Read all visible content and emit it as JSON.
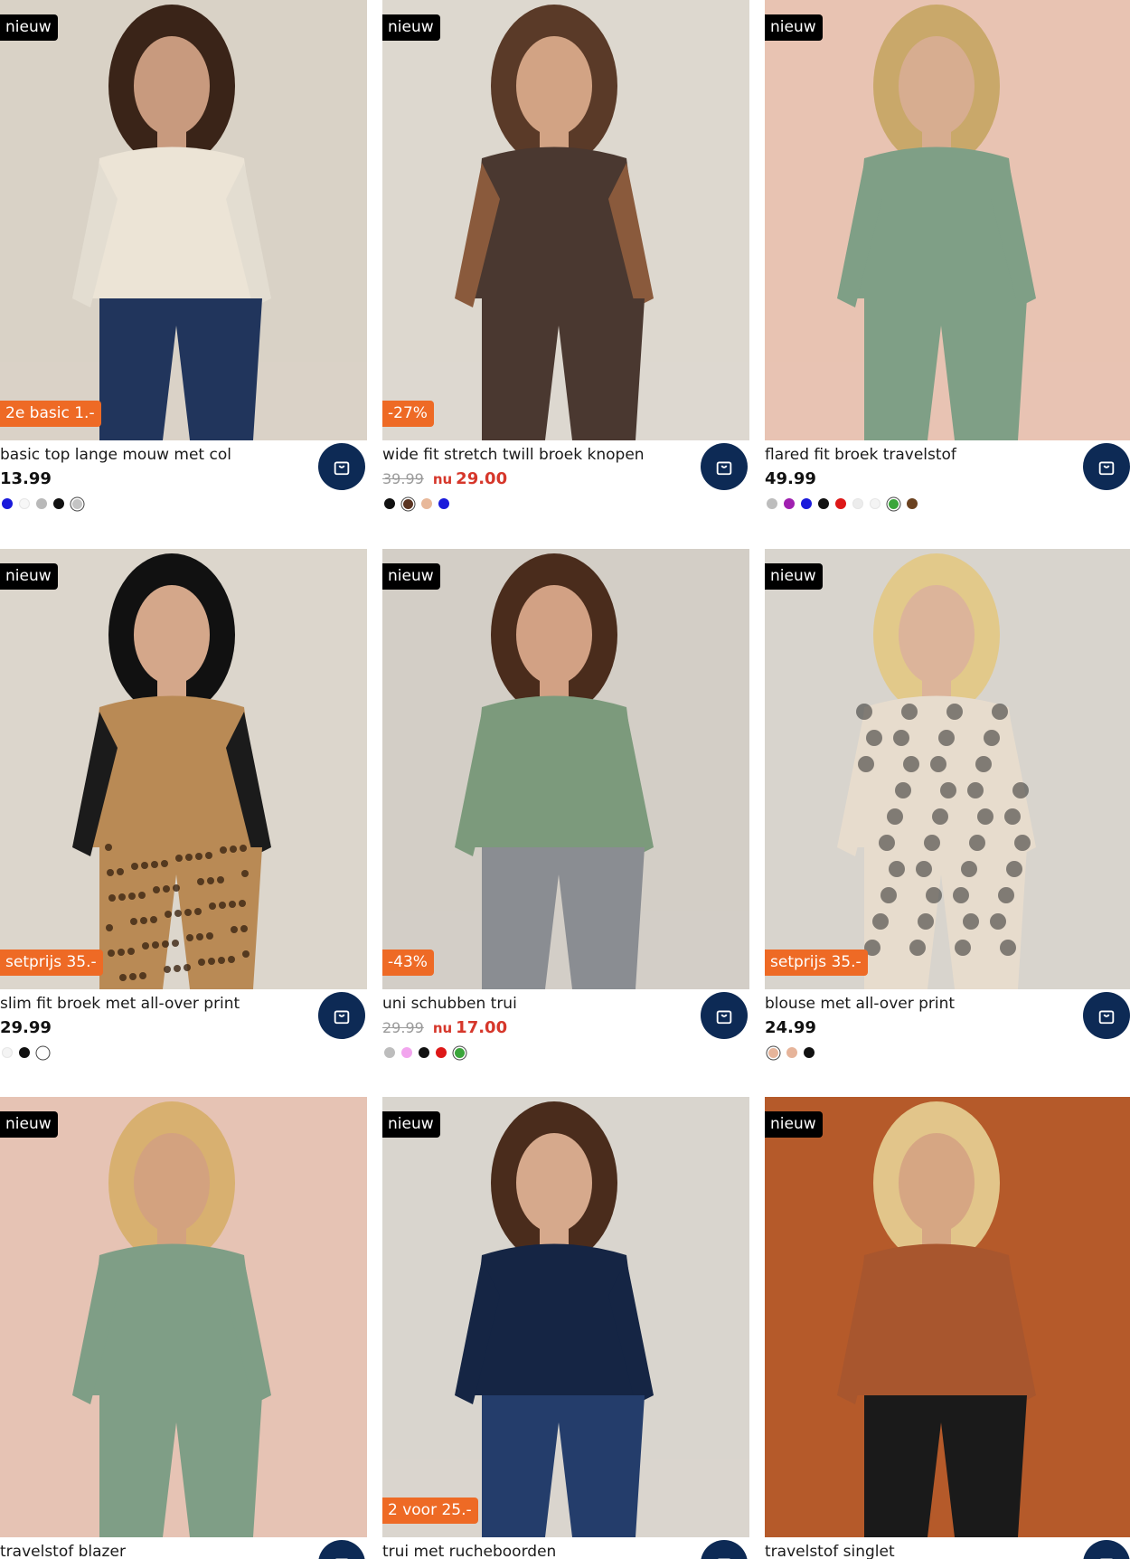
{
  "products": [
    {
      "name": "basic top lange mouw met col",
      "badge_new": "nieuw",
      "promo": "2e basic 1.-",
      "price": "13.99",
      "old_price": null,
      "sale_label": null,
      "sale_price": null,
      "colors": [
        {
          "hex": "#1a1adb"
        },
        {
          "hex": "#f7f7f7"
        },
        {
          "hex": "#b9b9b9"
        },
        {
          "hex": "#111111"
        },
        {
          "hex": "#c4c4c4",
          "selected": true
        }
      ]
    },
    {
      "name": "wide fit stretch twill broek knopen",
      "badge_new": "nieuw",
      "promo": "-27%",
      "price": null,
      "old_price": "39.99",
      "sale_label": "nu",
      "sale_price": "29.00",
      "colors": [
        {
          "hex": "#111111"
        },
        {
          "hex": "#5a3422",
          "selected": true
        },
        {
          "hex": "#e8b89a"
        },
        {
          "hex": "#1a1adb"
        }
      ]
    },
    {
      "name": "flared fit broek travelstof",
      "badge_new": "nieuw",
      "promo": null,
      "price": "49.99",
      "old_price": null,
      "sale_label": null,
      "sale_price": null,
      "colors": [
        {
          "hex": "#bdbdbd"
        },
        {
          "hex": "#a020b0"
        },
        {
          "hex": "#1a1adb"
        },
        {
          "hex": "#111111"
        },
        {
          "hex": "#dd1818"
        },
        {
          "hex": "#ececec"
        },
        {
          "hex": "#f4f4f4"
        },
        {
          "hex": "#3aa53a",
          "selected": true
        },
        {
          "hex": "#6b4220"
        }
      ]
    },
    {
      "name": "slim fit broek met all-over print",
      "badge_new": "nieuw",
      "promo": "setprijs 35.-",
      "price": "29.99",
      "old_price": null,
      "sale_label": null,
      "sale_price": null,
      "colors": [
        {
          "hex": "#f4f4f4"
        },
        {
          "hex": "#111111"
        },
        {
          "hex": "#ffffff",
          "selected": true
        }
      ]
    },
    {
      "name": "uni schubben trui",
      "badge_new": "nieuw",
      "promo": "-43%",
      "price": null,
      "old_price": "29.99",
      "sale_label": "nu",
      "sale_price": "17.00",
      "colors": [
        {
          "hex": "#bdbdbd"
        },
        {
          "hex": "#f2a5ee"
        },
        {
          "hex": "#111111"
        },
        {
          "hex": "#dd1818"
        },
        {
          "hex": "#3aa53a",
          "selected": true
        }
      ]
    },
    {
      "name": "blouse met all-over print",
      "badge_new": "nieuw",
      "promo": "setprijs 35.-",
      "price": "24.99",
      "old_price": null,
      "sale_label": null,
      "sale_price": null,
      "colors": [
        {
          "hex": "#e6b49a",
          "selected": true
        },
        {
          "hex": "#e6b49a"
        },
        {
          "hex": "#111111"
        }
      ]
    },
    {
      "name": "travelstof blazer",
      "badge_new": "nieuw",
      "promo": null,
      "price": null,
      "old_price": null,
      "sale_label": null,
      "sale_price": null,
      "colors": []
    },
    {
      "name": "trui met rucheboorden",
      "badge_new": "nieuw",
      "promo": "2 voor 25.-",
      "price": null,
      "old_price": null,
      "sale_label": null,
      "sale_price": null,
      "colors": []
    },
    {
      "name": "travelstof singlet",
      "badge_new": "nieuw",
      "promo": null,
      "price": null,
      "old_price": null,
      "sale_label": null,
      "sale_price": null,
      "colors": []
    }
  ],
  "icons": {
    "cart": "shopping-bag-icon"
  },
  "colors": {
    "cart_button": "#0d2a55",
    "promo_badge": "#ee6a25",
    "new_badge": "#000000",
    "sale_price": "#d6372b"
  }
}
